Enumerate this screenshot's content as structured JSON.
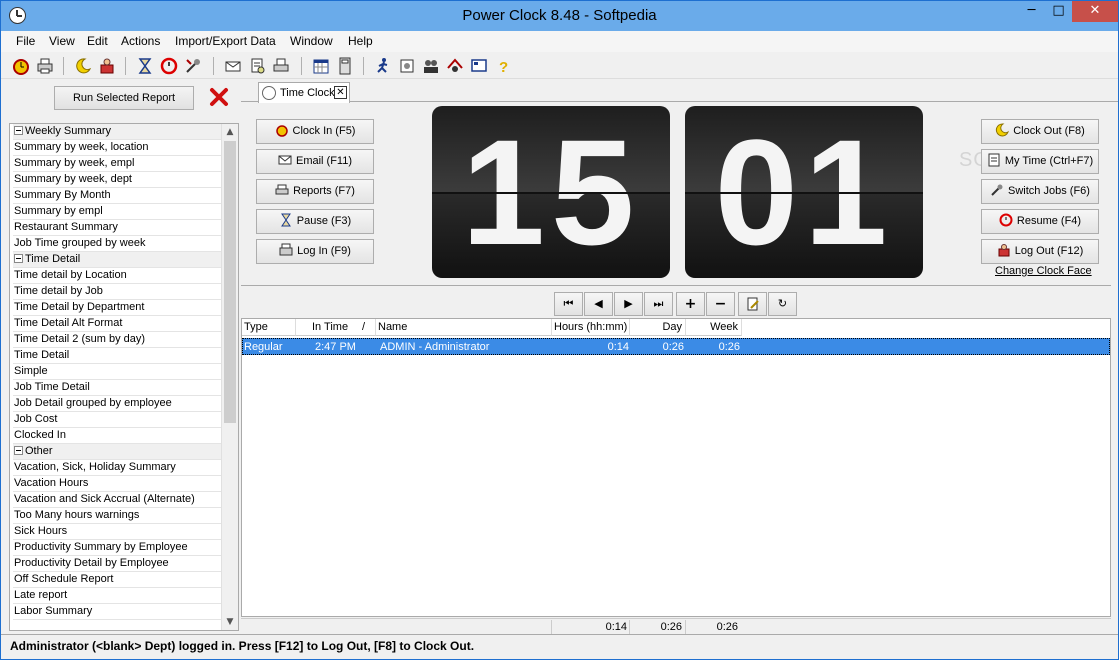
{
  "window": {
    "title": "Power Clock 8.48 - Softpedia",
    "minimize": "─",
    "maximize": "□",
    "close": "✕"
  },
  "menu": [
    "File",
    "View",
    "Edit",
    "Actions",
    "Import/Export Data",
    "Window",
    "Help"
  ],
  "toolbar": {
    "icons": [
      "clock-in-icon",
      "printer-icon",
      "clock-out-icon",
      "log-out-icon",
      "hourglass-icon",
      "resume-icon",
      "switch-jobs-icon",
      "email-icon",
      "reports-icon",
      "print-icon",
      "calendar-icon",
      "calculator-icon",
      "run-man-icon",
      "gear-edit-icon",
      "users-icon",
      "group-icon",
      "screen-icon",
      "help-icon"
    ]
  },
  "left": {
    "run_button": "Run Selected Report",
    "groups": [
      {
        "label": "Weekly Summary",
        "items": [
          "Summary by week, location",
          "Summary by week, empl",
          "Summary by week, dept",
          "Summary By Month",
          "Summary by empl",
          "Restaurant Summary",
          "Job Time grouped by week"
        ]
      },
      {
        "label": "Time Detail",
        "items": [
          "Time detail by Location",
          "Time detail by Job",
          "Time Detail by Department",
          "Time Detail Alt Format",
          "Time Detail 2 (sum by day)",
          "Time Detail",
          "Simple",
          "Job Time Detail",
          "Job Detail grouped by employee",
          "Job Cost",
          "Clocked In"
        ]
      },
      {
        "label": "Other",
        "items": [
          "Vacation, Sick, Holiday Summary",
          "Vacation Hours",
          "Vacation and Sick Accrual (Alternate)",
          "Too Many hours warnings",
          "Sick Hours",
          "Productivity Summary by Employee",
          "Productivity Detail by Employee",
          "Off Schedule Report",
          "Late report",
          "Labor Summary"
        ]
      }
    ]
  },
  "tab": {
    "label": "Time Clock",
    "close": "✕"
  },
  "clock": {
    "hours": "15",
    "minutes": "01"
  },
  "left_buttons": [
    "Clock In (F5)",
    "Email (F11)",
    "Reports (F7)",
    "Pause (F3)",
    "Log In (F9)"
  ],
  "right_buttons": [
    "Clock Out (F8)",
    "My Time (Ctrl+F7)",
    "Switch Jobs (F6)",
    "Resume (F4)",
    "Log Out (F12)"
  ],
  "change_clock_face": "Change Clock Face",
  "watermark": "SOFTPEDIA",
  "nav_buttons": [
    "⏮",
    "◀",
    "▶",
    "⏭",
    "+",
    "−",
    "",
    "↻"
  ],
  "grid": {
    "columns": [
      "Type",
      "In Time",
      "/",
      "Name",
      "Hours (hh:mm)",
      "Day",
      "Week"
    ],
    "rows": [
      {
        "type": "Regular",
        "in_time": "2:47 PM",
        "name": "ADMIN - Administrator",
        "hours": "0:14",
        "day": "0:26",
        "week": "0:26"
      }
    ],
    "totals": {
      "hours": "0:14",
      "day": "0:26",
      "week": "0:26"
    }
  },
  "status": "Administrator (<blank> Dept) logged in.  Press [F12] to Log Out, [F8] to Clock Out.",
  "colors": {
    "titlebar": "#6aabea",
    "selection": "#3b8be6",
    "close_button": "#c7504a"
  }
}
